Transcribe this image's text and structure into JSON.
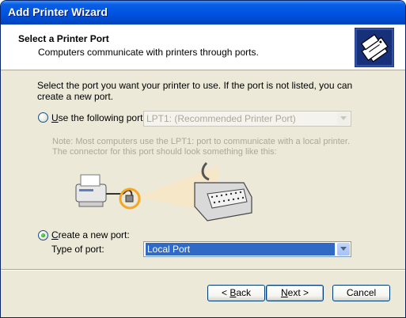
{
  "window": {
    "title": "Add Printer Wizard"
  },
  "header": {
    "title": "Select a Printer Port",
    "subtitle": "Computers communicate with printers through ports.",
    "icon": "printer-port-icon"
  },
  "intro_text": "Select the port you want your printer to use.  If the port is not listed, you can create a new port.",
  "option_existing": {
    "label_prefix": "U",
    "label_rest": "se the following port:",
    "selected": false,
    "combo_value": "LPT1: (Recommended Printer Port)"
  },
  "note_text": "Note: Most computers use the LPT1: port to communicate with a local printer. The connector for this port should look something like this:",
  "option_new": {
    "label_prefix": "C",
    "label_rest": "reate a new port:",
    "selected": true,
    "type_label_prefix": "Type of port:",
    "combo_value": "Local Port"
  },
  "buttons": {
    "back_prefix": "< ",
    "back_key": "B",
    "back_rest": "ack",
    "next_key": "N",
    "next_rest": "ext >",
    "cancel": "Cancel"
  },
  "colors": {
    "titlebar": "#0054e3",
    "dialog_bg": "#ece9d8",
    "selection": "#316ac5",
    "highlight_ring": "#f5a623"
  }
}
